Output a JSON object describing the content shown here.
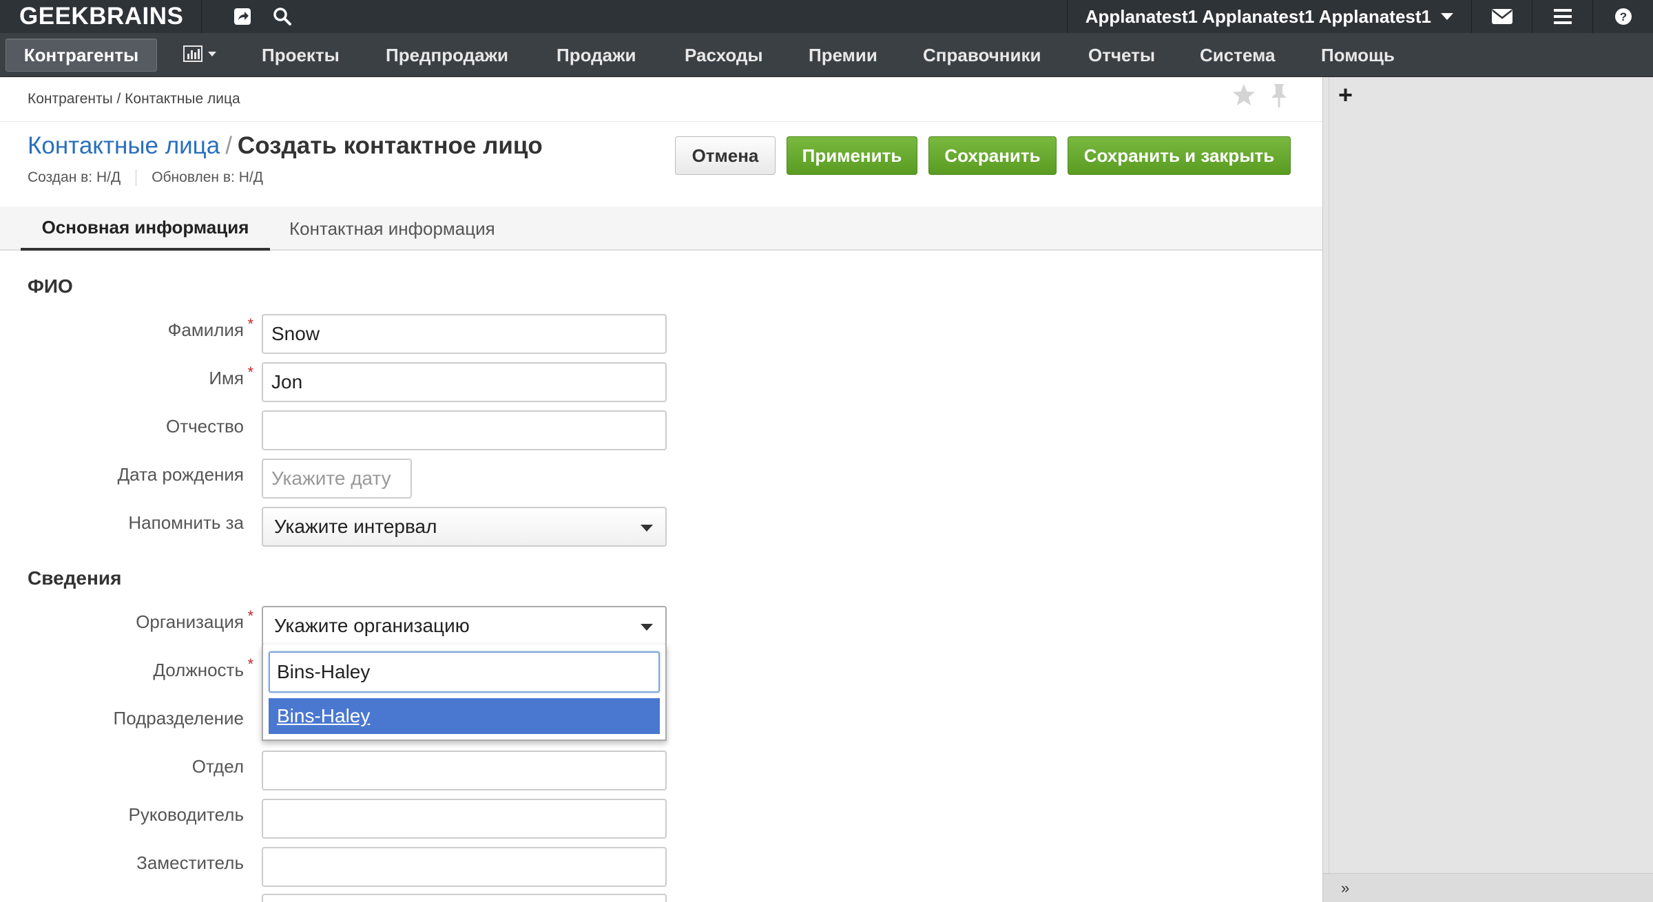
{
  "topbar": {
    "logo": "GEEKBRAINS",
    "user_name": "Applanatest1 Applanatest1 Applanatest1"
  },
  "nav": {
    "active": "Контрагенты",
    "items": [
      "Проекты",
      "Предпродажи",
      "Продажи",
      "Расходы",
      "Премии",
      "Справочники",
      "Отчеты",
      "Система",
      "Помощь"
    ]
  },
  "breadcrumb": "Контрагенты / Контактные лица",
  "page": {
    "title_link": "Контактные лица",
    "title_sep": "/",
    "title": "Создать контактное лицо",
    "created": "Создан в: Н/Д",
    "updated": "Обновлен в: Н/Д"
  },
  "buttons": {
    "cancel": "Отмена",
    "apply": "Применить",
    "save": "Сохранить",
    "save_close": "Сохранить и закрыть"
  },
  "tabs": [
    "Основная информация",
    "Контактная информация"
  ],
  "sections": {
    "fio": "ФИО",
    "info": "Сведения"
  },
  "fields": {
    "last_name": {
      "label": "Фамилия",
      "value": "Snow",
      "required": "*"
    },
    "first_name": {
      "label": "Имя",
      "value": "Jon",
      "required": "*"
    },
    "middle_name": {
      "label": "Отчество",
      "value": ""
    },
    "birth_date": {
      "label": "Дата рождения",
      "placeholder": "Укажите дату"
    },
    "remind": {
      "label": "Напомнить за",
      "value": "Укажите интервал"
    },
    "organization": {
      "label": "Организация",
      "value": "Укажите организацию",
      "required": "*"
    },
    "position": {
      "label": "Должность",
      "required": "*"
    },
    "subdivision": {
      "label": "Подразделение"
    },
    "department": {
      "label": "Отдел",
      "value": ""
    },
    "manager": {
      "label": "Руководитель",
      "value": ""
    },
    "deputy": {
      "label": "Заместитель",
      "value": ""
    }
  },
  "dropdown": {
    "search_value": "Bins-Haley",
    "option": "Bins-Haley"
  },
  "colors": {
    "topbar": "#2e3338",
    "navbar": "#3b4045",
    "accent_green": "#5a9b22",
    "link_blue": "#2a6fbd",
    "selected_option": "#4a78d0",
    "required": "#c0282e"
  }
}
